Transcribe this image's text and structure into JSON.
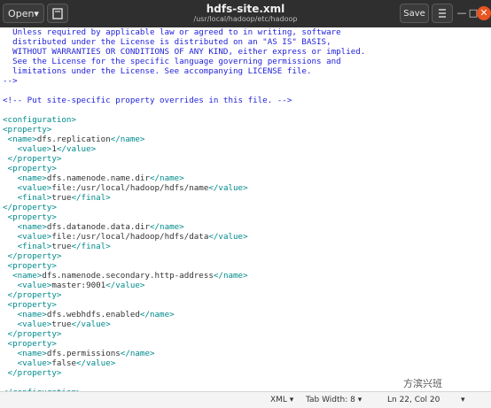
{
  "window": {
    "title": "hdfs-site.xml",
    "subtitle": "/usr/local/hadoop/etc/hadoop",
    "open_label": "Open▾",
    "save_label": "Save",
    "minimize_glyph": "—",
    "maximize_glyph": "□",
    "close_glyph": "✕"
  },
  "editor": {
    "lines": [
      {
        "kind": "comment",
        "text": "  Unless required by applicable law or agreed to in writing, software"
      },
      {
        "kind": "comment",
        "text": "  distributed under the License is distributed on an \"AS IS\" BASIS,"
      },
      {
        "kind": "comment",
        "text": "  WITHOUT WARRANTIES OR CONDITIONS OF ANY KIND, either express or implied."
      },
      {
        "kind": "comment",
        "text": "  See the License for the specific language governing permissions and"
      },
      {
        "kind": "comment",
        "text": "  limitations under the License. See accompanying LICENSE file."
      },
      {
        "kind": "comment",
        "text": "-->"
      },
      {
        "kind": "blank",
        "text": ""
      },
      {
        "kind": "comment",
        "text": "<!-- Put site-specific property overrides in this file. -->"
      },
      {
        "kind": "blank",
        "text": ""
      },
      {
        "kind": "tag",
        "text": "<configuration>"
      },
      {
        "kind": "tag",
        "text": "<property>"
      },
      {
        "kind": "el",
        "indent": " ",
        "open": "<name>",
        "value": "dfs.replication",
        "close": "</name>"
      },
      {
        "kind": "el",
        "indent": "   ",
        "open": "<value>",
        "value": "1",
        "close": "</value>"
      },
      {
        "kind": "tag",
        "text": " </property>"
      },
      {
        "kind": "tag",
        "text": " <property>"
      },
      {
        "kind": "el",
        "indent": "   ",
        "open": "<name>",
        "value": "dfs.namenode.name.dir",
        "close": "</name>"
      },
      {
        "kind": "el",
        "indent": "   ",
        "open": "<value>",
        "value": "file:/usr/local/hadoop/hdfs/name",
        "close": "</value>"
      },
      {
        "kind": "el",
        "indent": "   ",
        "open": "<final>",
        "value": "true",
        "close": "</final>"
      },
      {
        "kind": "tag",
        "text": "</property>"
      },
      {
        "kind": "tag",
        "text": " <property>"
      },
      {
        "kind": "el",
        "indent": "   ",
        "open": "<name>",
        "value": "dfs.datanode.data.dir",
        "close": "</name>"
      },
      {
        "kind": "el",
        "indent": "   ",
        "open": "<value>",
        "value": "file:/usr/local/hadoop/hdfs/data",
        "close": "</value>"
      },
      {
        "kind": "el",
        "indent": "   ",
        "open": "<final>",
        "value": "true",
        "close": "</final>"
      },
      {
        "kind": "tag",
        "text": " </property>"
      },
      {
        "kind": "tag",
        "text": " <property>"
      },
      {
        "kind": "el",
        "indent": "  ",
        "open": "<name>",
        "value": "dfs.namenode.secondary.http-address",
        "close": "</name>"
      },
      {
        "kind": "el",
        "indent": "   ",
        "open": "<value>",
        "value": "master:9001",
        "close": "</value>"
      },
      {
        "kind": "tag",
        "text": " </property>"
      },
      {
        "kind": "tag",
        "text": " <property>"
      },
      {
        "kind": "el",
        "indent": "   ",
        "open": "<name>",
        "value": "dfs.webhdfs.enabled",
        "close": "</name>"
      },
      {
        "kind": "el",
        "indent": "   ",
        "open": "<value>",
        "value": "true",
        "close": "</value>"
      },
      {
        "kind": "tag",
        "text": " </property>"
      },
      {
        "kind": "tag",
        "text": " <property>"
      },
      {
        "kind": "el",
        "indent": "   ",
        "open": "<name>",
        "value": "dfs.permissions",
        "close": "</name>"
      },
      {
        "kind": "el",
        "indent": "   ",
        "open": "<value>",
        "value": "false",
        "close": "</value>"
      },
      {
        "kind": "tag",
        "text": " </property>"
      },
      {
        "kind": "blank",
        "text": ""
      },
      {
        "kind": "tag",
        "text": "</configuration>"
      }
    ]
  },
  "statusbar": {
    "language": "XML ▾",
    "tab_width": "Tab Width: 8 ▾",
    "position": "Ln 22, Col 20",
    "mode": "▾"
  },
  "watermark": "方滨兴班",
  "colors": {
    "titlebar": "#2f2f2f",
    "tag": "#008a8c",
    "comment": "#1f1fd9",
    "accent_close": "#e95420"
  }
}
